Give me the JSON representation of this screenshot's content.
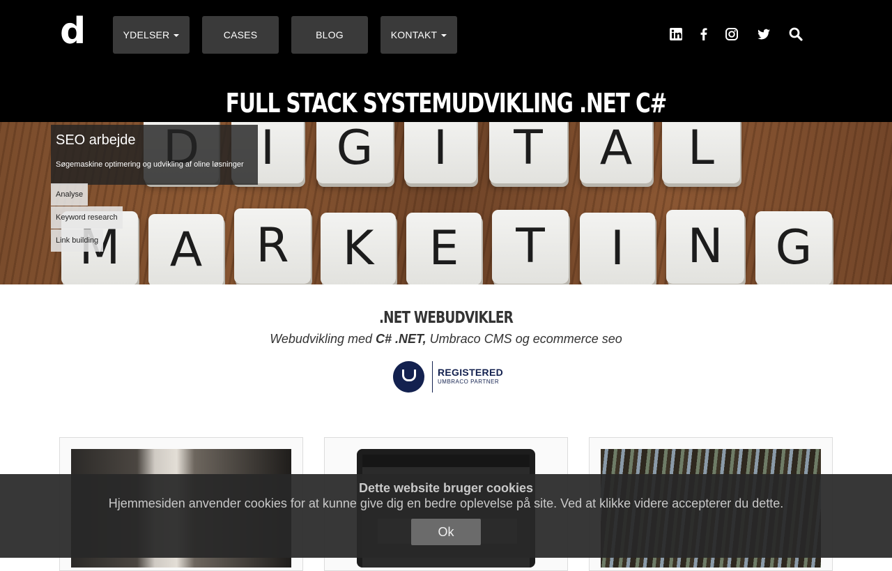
{
  "logo": {
    "text": "d"
  },
  "nav": {
    "items": [
      {
        "label": "YDELSER",
        "dropdown": true
      },
      {
        "label": "CASES",
        "dropdown": false
      },
      {
        "label": "BLOG",
        "dropdown": false
      },
      {
        "label": "KONTAKT",
        "dropdown": true
      }
    ]
  },
  "social": [
    "linkedin-icon",
    "facebook-icon",
    "instagram-icon",
    "twitter-icon",
    "search-icon"
  ],
  "page_title": "FULL STACK SYSTEMUDVIKLING .NET C#",
  "hero": {
    "tiles_row1": [
      "D",
      "I",
      "G",
      "I",
      "T",
      "A",
      "L"
    ],
    "tiles_row2": [
      "M",
      "A",
      "R",
      "K",
      "E",
      "T",
      "I",
      "N",
      "G"
    ],
    "seo_title": "SEO arbejde",
    "seo_subtitle": "Søgemaskine optimering og udvikling af oline løsninger",
    "tags": [
      "Analyse",
      "Keyword research",
      "Link building"
    ]
  },
  "intro": {
    "title": ".NET WEBUDVIKLER",
    "sub_prefix": "Webudvikling med ",
    "sub_bold": "C# .NET,",
    "sub_suffix": " Umbraco CMS og ecommerce seo"
  },
  "badge": {
    "registered": "REGISTERED",
    "partner": "UMBRACO PARTNER",
    "brand_color": "#13214f"
  },
  "cookie": {
    "title": "Dette website bruger cookies",
    "text": "Hjemmesiden anvender cookies for at kunne give dig en bedre oplevelse på site. Ved at klikke videre accepterer du dette.",
    "ok_label": "Ok"
  }
}
